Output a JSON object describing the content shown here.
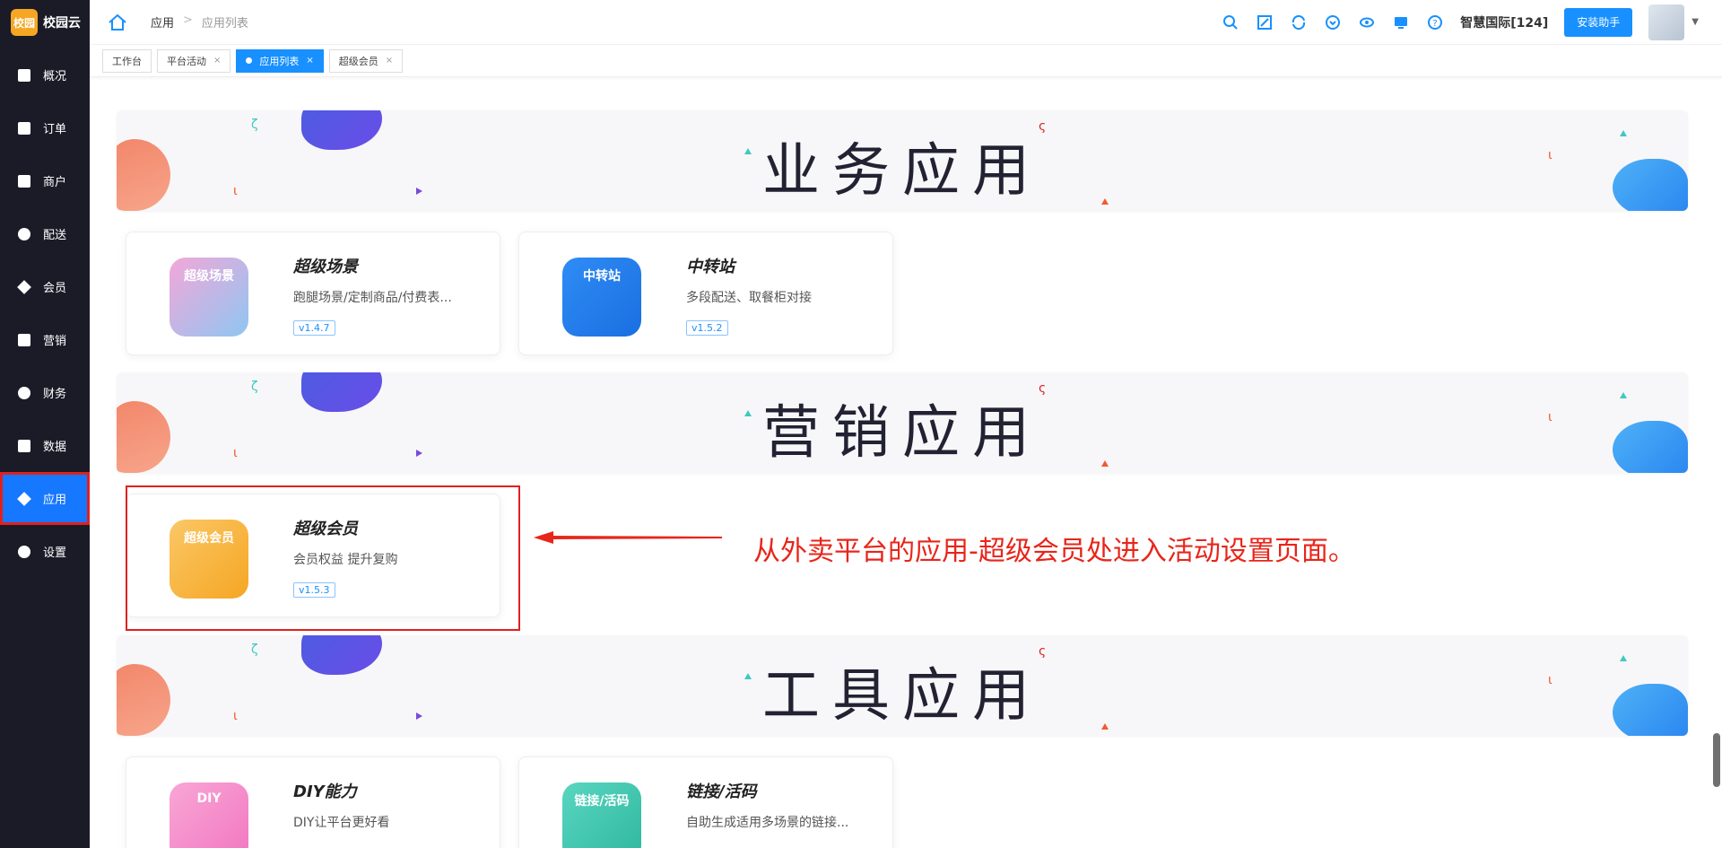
{
  "brand": {
    "badge": "校园",
    "name": "校园云"
  },
  "sidebar": {
    "items": [
      {
        "label": "概况",
        "icon": "monitor-icon"
      },
      {
        "label": "订单",
        "icon": "order-icon"
      },
      {
        "label": "商户",
        "icon": "shop-icon"
      },
      {
        "label": "配送",
        "icon": "delivery-icon"
      },
      {
        "label": "会员",
        "icon": "diamond-icon"
      },
      {
        "label": "营销",
        "icon": "ticket-icon"
      },
      {
        "label": "财务",
        "icon": "money-bag-icon"
      },
      {
        "label": "数据",
        "icon": "chart-icon"
      },
      {
        "label": "应用",
        "icon": "cube-icon",
        "active": true
      },
      {
        "label": "设置",
        "icon": "gear-icon"
      }
    ]
  },
  "header": {
    "breadcrumb": [
      "应用",
      "应用列表"
    ],
    "org_name": "智慧国际[124]",
    "install_button": "安装助手"
  },
  "tabs": [
    {
      "label": "工作台",
      "closable": false
    },
    {
      "label": "平台活动",
      "closable": true
    },
    {
      "label": "应用列表",
      "closable": true,
      "active": true
    },
    {
      "label": "超级会员",
      "closable": true
    }
  ],
  "sections": [
    {
      "title": "业务应用"
    },
    {
      "title": "营销应用"
    },
    {
      "title": "工具应用"
    }
  ],
  "apps": {
    "super_scene": {
      "name": "超级场景",
      "desc": "跑腿场景/定制商品/付费表...",
      "version": "v1.4.7",
      "icon_text": "超级场景"
    },
    "transfer": {
      "name": "中转站",
      "desc": "多段配送、取餐柜对接",
      "version": "v1.5.2",
      "icon_text": "中转站"
    },
    "super_member": {
      "name": "超级会员",
      "desc": "会员权益 提升复购",
      "version": "v1.5.3",
      "icon_text": "超级会员"
    },
    "diy": {
      "name": "DIY能力",
      "desc": "DIY让平台更好看",
      "version": "",
      "icon_text": "DIY"
    },
    "link": {
      "name": "链接/活码",
      "desc": "自助生成适用多场景的链接...",
      "version": "",
      "icon_text": "链接/活码"
    }
  },
  "annotation": "从外卖平台的应用-超级会员处进入活动设置页面。",
  "colors": {
    "primary": "#1890ff",
    "sidebar_bg": "#1b1b28",
    "highlight_red": "#e02020"
  }
}
